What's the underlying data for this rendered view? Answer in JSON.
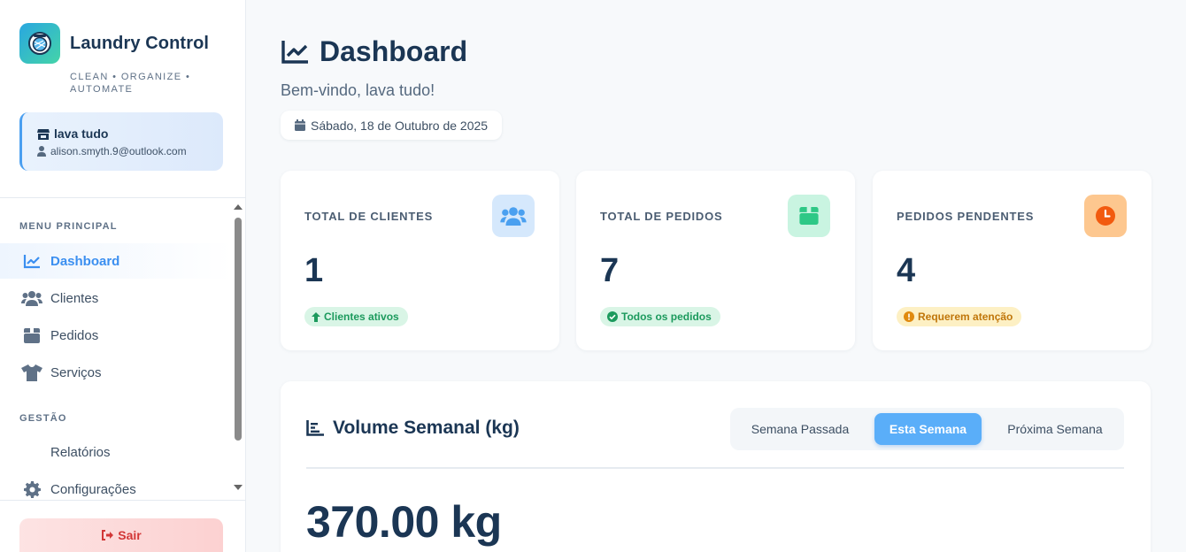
{
  "brand": {
    "name": "Laundry Control",
    "tagline": "CLEAN • ORGANIZE • AUTOMATE"
  },
  "user": {
    "store_name": "lava tudo",
    "email": "alison.smyth.9@outlook.com"
  },
  "sidebar": {
    "main_label": "MENU PRINCIPAL",
    "main_items": [
      {
        "label": "Dashboard",
        "icon": "chart-line-icon",
        "active": true
      },
      {
        "label": "Clientes",
        "icon": "users-icon"
      },
      {
        "label": "Pedidos",
        "icon": "box-icon"
      },
      {
        "label": "Serviços",
        "icon": "shirt-icon"
      }
    ],
    "manage_label": "GESTÃO",
    "manage_items": [
      {
        "label": "Relatórios"
      },
      {
        "label": "Configurações",
        "icon": "gear-icon"
      }
    ],
    "logout_label": "Sair"
  },
  "header": {
    "title": "Dashboard",
    "welcome": "Bem-vindo, lava tudo!",
    "date": "Sábado, 18 de Outubro de 2025"
  },
  "stats": [
    {
      "label": "TOTAL DE CLIENTES",
      "value": "1",
      "badge": "Clientes ativos",
      "icon": "users-icon",
      "color": "#4aa0f0"
    },
    {
      "label": "TOTAL DE PEDIDOS",
      "value": "7",
      "badge": "Todos os pedidos",
      "icon": "box-icon",
      "color": "#2ec886"
    },
    {
      "label": "PEDIDOS PENDENTES",
      "value": "4",
      "badge": "Requerem atenção",
      "icon": "clock-icon",
      "color": "#f07a1a"
    }
  ],
  "volume": {
    "title": "Volume Semanal (kg)",
    "tabs": [
      "Semana Passada",
      "Esta Semana",
      "Próxima Semana"
    ],
    "active_tab": "Esta Semana",
    "value": "370.00 kg"
  },
  "colors": {
    "primary": "#5aaef9",
    "text_dark": "#1b3654",
    "danger": "#d23737"
  }
}
